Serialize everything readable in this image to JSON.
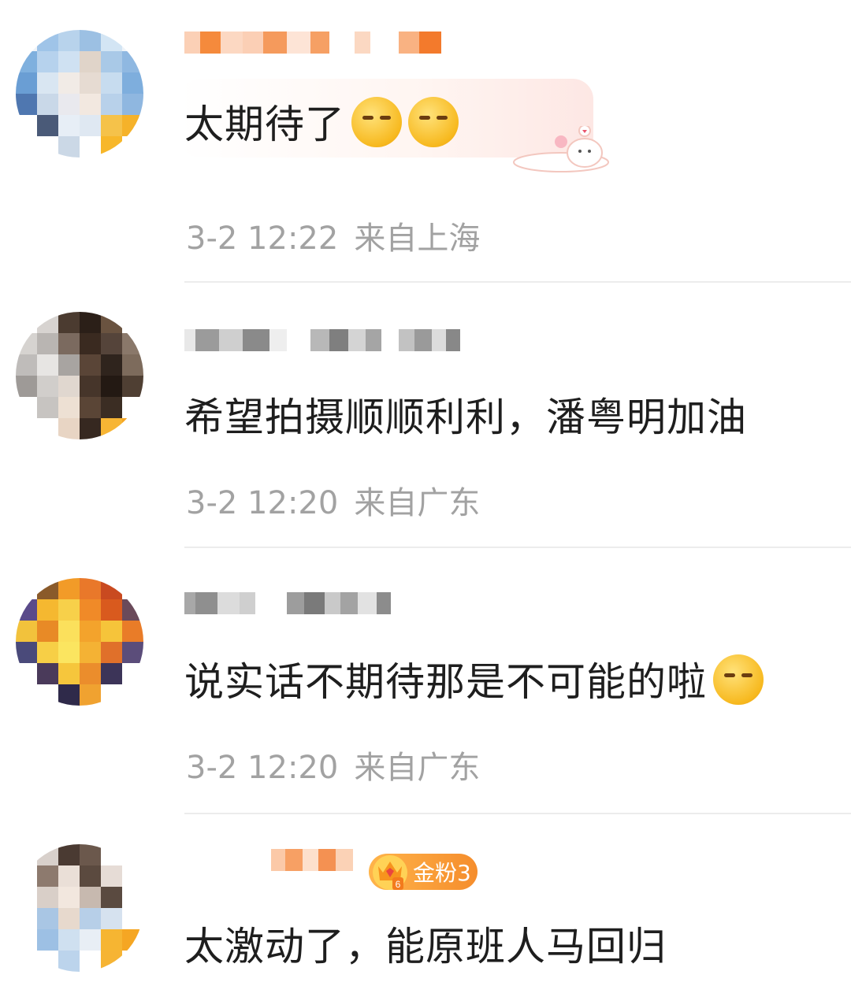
{
  "comments": [
    {
      "text": "太期待了",
      "time": "3-2 12:22",
      "location": "来自上海",
      "emojis": [
        "blushing-praying-emoji",
        "blushing-praying-emoji"
      ]
    },
    {
      "text": "希望拍摄顺顺利利，潘粤明加油",
      "time": "3-2 12:20",
      "location": "来自广东"
    },
    {
      "text": "说实话不期待那是不可能的啦",
      "time": "3-2 12:20",
      "location": "来自广东",
      "emojis": [
        "love-smiling-emoji"
      ]
    },
    {
      "text": "太激动了，能原班人马回归",
      "badge": "金粉3",
      "badge_level": "6"
    }
  ],
  "colors": {
    "text": "#1e1e1e",
    "meta": "#a2a2a2",
    "divider": "#ececec",
    "badge": "#f58d2c"
  }
}
